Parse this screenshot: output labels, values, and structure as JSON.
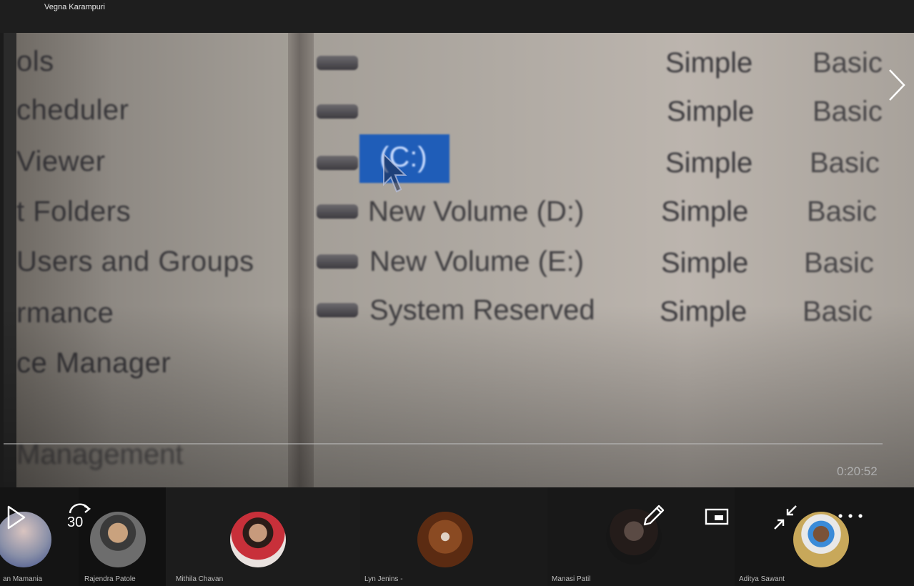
{
  "presenter_name": "Vegna Karampuri",
  "video": {
    "left_panel_items": [
      "ols",
      "cheduler",
      "Viewer",
      "t Folders",
      "Users and Groups",
      "rmance",
      "ce Manager"
    ],
    "bottom_label": "Management",
    "volumes": [
      {
        "name": "",
        "layout": "Simple",
        "type": "Basic"
      },
      {
        "name": "",
        "layout": "Simple",
        "type": "Basic"
      },
      {
        "name": "(C:)",
        "layout": "Simple",
        "type": "Basic",
        "selected": true
      },
      {
        "name": "New Volume (D:)",
        "layout": "Simple",
        "type": "Basic"
      },
      {
        "name": "New Volume (E:)",
        "layout": "Simple",
        "type": "Basic"
      },
      {
        "name": "System Reserved",
        "layout": "Simple",
        "type": "Basic"
      }
    ],
    "elapsed_time": "0:20:52"
  },
  "controls": {
    "play_icon": "play-icon",
    "skip_label": "30",
    "skip_icon": "skip-forward-30-icon",
    "pen_icon": "pencil-icon",
    "pip_icon": "picture-in-picture-icon",
    "minimize_icon": "collapse-icon",
    "more_icon": "more-options-icon"
  },
  "participants": [
    {
      "name": "an Mamania"
    },
    {
      "name": "Rajendra Patole"
    },
    {
      "name": "Mithila Chavan"
    },
    {
      "name": "Lyn Jenins -"
    },
    {
      "name": "Manasi Patil"
    },
    {
      "name": "Aditya  Sawant"
    }
  ],
  "colors": {
    "selection": "#1f5db8",
    "strip_bg": "#141414"
  }
}
